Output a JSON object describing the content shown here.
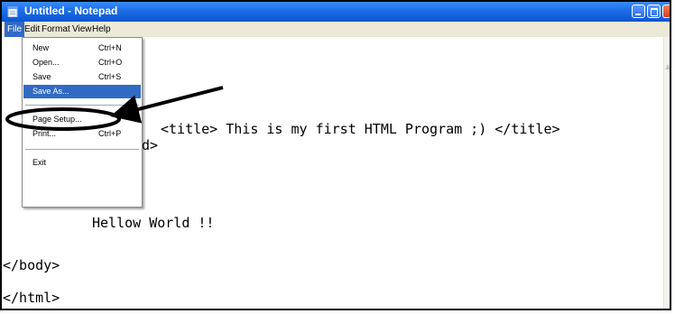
{
  "window": {
    "title": "Untitled - Notepad"
  },
  "menubar": [
    "File",
    "Edit",
    "Format",
    "View",
    "Help"
  ],
  "file_menu": {
    "items": [
      {
        "label": "New",
        "shortcut": "Ctrl+N"
      },
      {
        "label": "Open...",
        "shortcut": "Ctrl+O"
      },
      {
        "label": "Save",
        "shortcut": "Ctrl+S"
      },
      {
        "label": "Save As...",
        "shortcut": ""
      },
      {
        "label": "Page Setup...",
        "shortcut": ""
      },
      {
        "label": "Print...",
        "shortcut": "Ctrl+P"
      },
      {
        "label": "Exit",
        "shortcut": ""
      }
    ],
    "highlighted": "Save As..."
  },
  "editor": {
    "lines": [
      "<title> This is my first HTML Program ;) </title>",
      "d>",
      "Hellow World !!",
      "</body>",
      "</html>"
    ]
  },
  "colors": {
    "titlebar": "#0a55d4",
    "menu_highlight": "#316ac5",
    "annotation": "#000000"
  },
  "icons": [
    "notepad-icon",
    "minimize-icon",
    "maximize-icon",
    "close-icon"
  ]
}
